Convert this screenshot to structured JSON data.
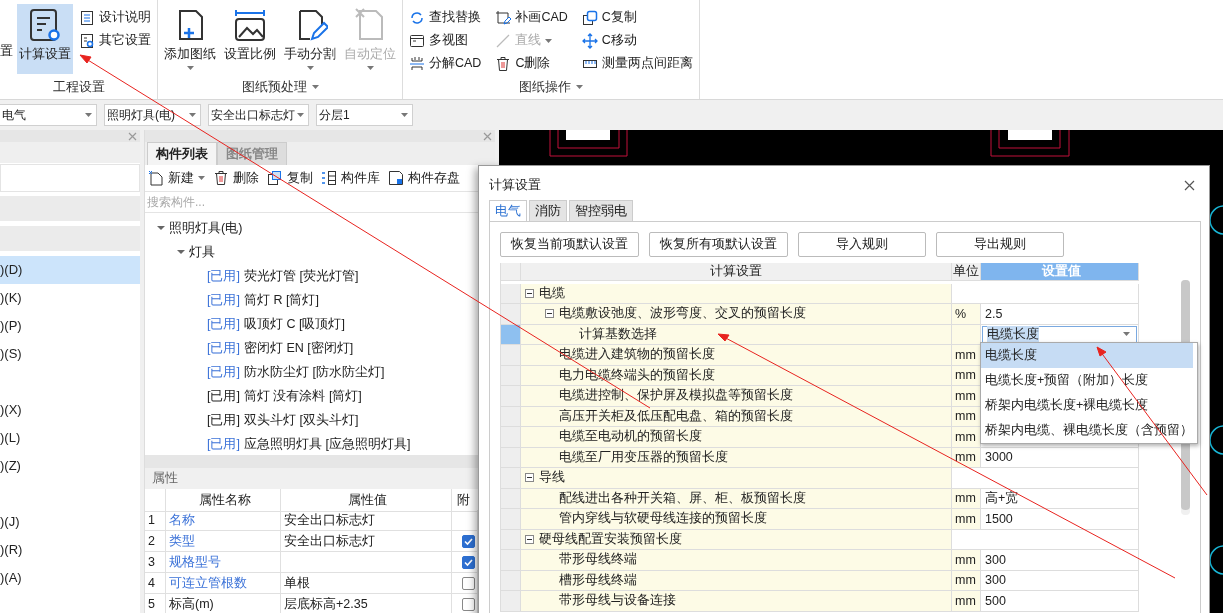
{
  "ribbon": {
    "groups": [
      {
        "label": "工程设置",
        "has_menu": false,
        "cut_label": "置",
        "big_buttons": [
          {
            "label": "计算设置",
            "selected": true,
            "disabled": false,
            "dropdown": false
          }
        ],
        "small_buttons": [
          {
            "label": "设计说明",
            "disabled": false,
            "dropdown": false
          },
          {
            "label": "其它设置",
            "disabled": false,
            "dropdown": false
          }
        ]
      },
      {
        "label": "图纸预处理",
        "has_menu": true,
        "big_buttons": [
          {
            "label": "添加图纸",
            "selected": false,
            "disabled": false,
            "dropdown": true
          },
          {
            "label": "设置比例",
            "selected": false,
            "disabled": false,
            "dropdown": false
          },
          {
            "label": "手动分割",
            "selected": false,
            "disabled": false,
            "dropdown": true
          },
          {
            "label": "自动定位",
            "selected": false,
            "disabled": true,
            "dropdown": true
          }
        ]
      },
      {
        "label": "图纸操作",
        "has_menu": true,
        "small_buttons": [
          {
            "label": "查找替换",
            "disabled": false,
            "dropdown": false
          },
          {
            "label": "补画CAD",
            "disabled": false,
            "dropdown": false
          },
          {
            "label": "C复制",
            "disabled": false,
            "dropdown": false
          },
          {
            "label": "多视图",
            "disabled": false,
            "dropdown": false
          },
          {
            "label": "直线",
            "disabled": true,
            "dropdown": true
          },
          {
            "label": "C移动",
            "disabled": false,
            "dropdown": false
          },
          {
            "label": "分解CAD",
            "disabled": false,
            "dropdown": false
          },
          {
            "label": "C删除",
            "disabled": false,
            "dropdown": false
          },
          {
            "label": "测量两点间距离",
            "disabled": false,
            "dropdown": false
          }
        ]
      }
    ]
  },
  "filters": [
    {
      "value": "电气"
    },
    {
      "value": "照明灯具(电)"
    },
    {
      "value": "安全出口标志灯"
    },
    {
      "value": "分层1"
    }
  ],
  "left_panel": {
    "groups": [
      {
        "items": [
          {
            "label": ")(D)",
            "selected": true
          },
          {
            "label": ")(K)",
            "selected": false
          },
          {
            "label": ")(P)",
            "selected": false
          },
          {
            "label": ")(S)",
            "selected": false
          }
        ]
      },
      {
        "items": [
          {
            "label": ")(X)",
            "selected": false
          },
          {
            "label": ")(L)",
            "selected": false
          },
          {
            "label": ")(Z)",
            "selected": false
          }
        ]
      },
      {
        "items": [
          {
            "label": ")(J)",
            "selected": false
          },
          {
            "label": ")(R)",
            "selected": false
          },
          {
            "label": ")(A)",
            "selected": false
          }
        ]
      }
    ]
  },
  "middle_panel": {
    "tabs": [
      {
        "label": "构件列表",
        "selected": true
      },
      {
        "label": "图纸管理",
        "selected": false
      }
    ],
    "toolbar": [
      {
        "label": "新建",
        "dropdown": true
      },
      {
        "label": "删除",
        "dropdown": false
      },
      {
        "label": "复制",
        "dropdown": false
      },
      {
        "label": "构件库",
        "dropdown": false
      },
      {
        "label": "构件存盘",
        "dropdown": false
      }
    ],
    "search": {
      "placeholder": "搜索构件..."
    },
    "tree": [
      {
        "label": "照明灯具(电)",
        "expanded": true,
        "children": [
          {
            "label": "灯具",
            "expanded": true,
            "children": [
              {
                "tag": "[已用]",
                "label": "荧光灯管 [荧光灯管]",
                "highlighted": true
              },
              {
                "tag": "[已用]",
                "label": "筒灯 R [筒灯]",
                "highlighted": true
              },
              {
                "tag": "[已用]",
                "label": "吸顶灯 C [吸顶灯]",
                "highlighted": true
              },
              {
                "tag": "[已用]",
                "label": "密闭灯 EN [密闭灯]",
                "highlighted": true
              },
              {
                "tag": "[已用]",
                "label": "防水防尘灯 [防水防尘灯]",
                "highlighted": true
              },
              {
                "tag": "[已用]",
                "label": "筒灯 没有涂料 [筒灯]",
                "highlighted": false
              },
              {
                "tag": "[已用]",
                "label": "双头斗灯 [双头斗灯]",
                "highlighted": false
              },
              {
                "tag": "[已用]",
                "label": "应急照明灯具 [应急照明灯具]",
                "highlighted": true
              }
            ]
          }
        ]
      }
    ]
  },
  "properties": {
    "title": "属性",
    "columns": [
      "属性名称",
      "属性值",
      "附"
    ],
    "rows": [
      {
        "index": "1",
        "name": "名称",
        "value": "安全出口标志灯",
        "highlighted": true
      },
      {
        "index": "2",
        "name": "类型",
        "value": "安全出口标志灯",
        "highlighted": true,
        "checked": true
      },
      {
        "index": "3",
        "name": "规格型号",
        "highlighted": true,
        "checked": true
      },
      {
        "index": "4",
        "name": "可连立管根数",
        "value": "单根",
        "highlighted": true,
        "checked": false
      },
      {
        "index": "5",
        "name": "标高(m)",
        "value": "层底标高+2.35",
        "highlighted": false,
        "checked": false
      }
    ]
  },
  "dialog": {
    "title": "计算设置",
    "tabs": [
      {
        "label": "电气",
        "selected": true
      },
      {
        "label": "消防",
        "selected": false
      },
      {
        "label": "智控弱电",
        "selected": false
      }
    ],
    "buttons": [
      "恢复当前项默认设置",
      "恢复所有项默认设置",
      "导入规则",
      "导出规则"
    ],
    "table": {
      "columns": [
        "计算设置",
        "单位",
        "设置值"
      ],
      "rows": [
        {
          "kind": "group",
          "label": "电缆",
          "expanded": true,
          "selected": false,
          "children": [
            {
              "kind": "item",
              "label": "电缆敷设弛度、波形弯度、交叉的预留长度",
              "unit": "%",
              "value": "2.5",
              "expanded": true,
              "selected": false,
              "children": [
                {
                  "kind": "combo",
                  "label": "计算基数选择",
                  "value": "电缆长度",
                  "selected": true
                }
              ]
            },
            {
              "kind": "item",
              "label": "电缆进入建筑物的预留长度",
              "unit": "mm",
              "selected": false
            },
            {
              "kind": "item",
              "label": "电力电缆终端头的预留长度",
              "unit": "mm",
              "selected": false
            },
            {
              "kind": "item",
              "label": "电缆进控制、保护屏及模拟盘等预留长度",
              "unit": "mm",
              "selected": false
            },
            {
              "kind": "item",
              "label": "高压开关柜及低压配电盘、箱的预留长度",
              "unit": "mm",
              "selected": false
            },
            {
              "kind": "item",
              "label": "电缆至电动机的预留长度",
              "unit": "mm",
              "selected": false
            },
            {
              "kind": "item",
              "label": "电缆至厂用变压器的预留长度",
              "unit": "mm",
              "value": "3000",
              "selected": false
            }
          ]
        },
        {
          "kind": "group",
          "label": "导线",
          "expanded": true,
          "selected": false,
          "children": [
            {
              "kind": "item",
              "label": "配线进出各种开关箱、屏、柜、板预留长度",
              "unit": "mm",
              "value": "高+宽",
              "selected": false
            },
            {
              "kind": "item",
              "label": "管内穿线与软硬母线连接的预留长度",
              "unit": "mm",
              "value": "1500",
              "selected": false
            }
          ]
        },
        {
          "kind": "group",
          "label": "硬母线配置安装预留长度",
          "expanded": true,
          "selected": false,
          "children": [
            {
              "kind": "item",
              "label": "带形母线终端",
              "unit": "mm",
              "value": "300",
              "selected": false
            },
            {
              "kind": "item",
              "label": "槽形母线终端",
              "unit": "mm",
              "value": "300",
              "selected": false
            },
            {
              "kind": "item",
              "label": "带形母线与设备连接",
              "unit": "mm",
              "value": "500",
              "selected": false
            }
          ]
        }
      ],
      "dropdown_options": [
        {
          "label": "电缆长度",
          "selected": true
        },
        {
          "label": "电缆长度+预留（附加）长度",
          "selected": false
        },
        {
          "label": "桥架内电缆长度+裸电缆长度",
          "selected": false
        },
        {
          "label": "桥架内电缆、裸电缆长度（含预留）",
          "selected": false
        }
      ]
    }
  }
}
